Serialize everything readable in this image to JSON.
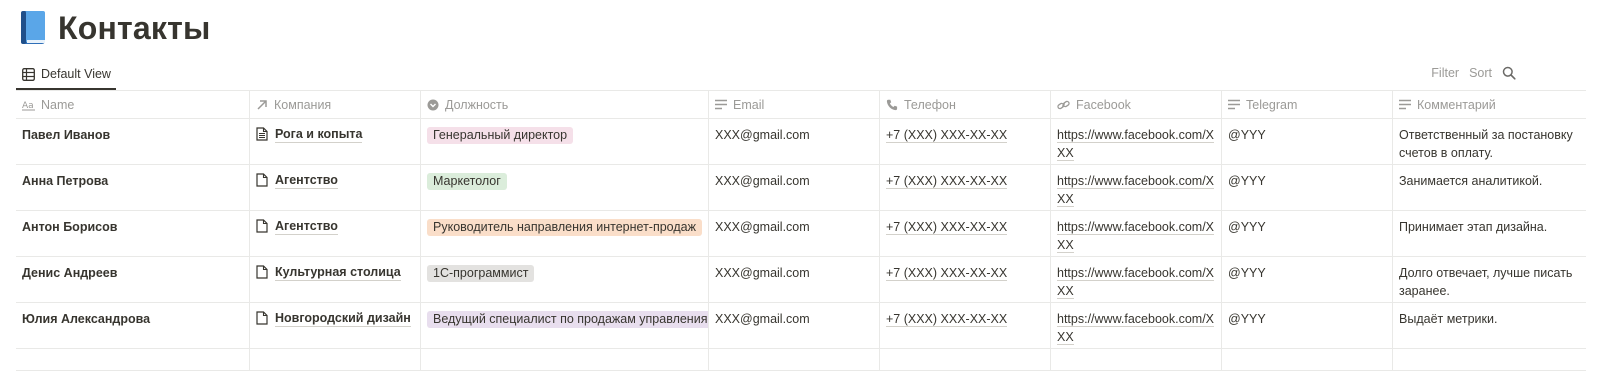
{
  "page": {
    "title": "Контакты",
    "icon": "blue-book-icon"
  },
  "toolbar": {
    "view_label": "Default View",
    "filter_label": "Filter",
    "sort_label": "Sort"
  },
  "columns": {
    "name": {
      "label": "Name",
      "icon": "text-aa-icon"
    },
    "company": {
      "label": "Компания",
      "icon": "relation-arrow-icon"
    },
    "position": {
      "label": "Должность",
      "icon": "select-icon"
    },
    "email": {
      "label": "Email",
      "icon": "lines-icon"
    },
    "phone": {
      "label": "Телефон",
      "icon": "phone-icon"
    },
    "facebook": {
      "label": "Facebook",
      "icon": "link-icon"
    },
    "telegram": {
      "label": "Telegram",
      "icon": "lines-icon"
    },
    "comment": {
      "label": "Комментарий",
      "icon": "lines-icon"
    }
  },
  "rows": [
    {
      "name": "Павел Иванов",
      "company": "Рога и копыта",
      "company_icon": "document-filled-icon",
      "position": "Генеральный директор",
      "position_color": "#f5e0e9",
      "email": "XXX@gmail.com",
      "phone": "+7 (XXX) XXX-XX-XX",
      "facebook": "https://www.facebook.com/XXX",
      "telegram": "@YYY",
      "comment": "Ответственный за постановку счетов в оплату."
    },
    {
      "name": "Анна Петрова",
      "company": "Агентство",
      "company_icon": "document-icon",
      "position": "Маркетолог",
      "position_color": "#dbeddb",
      "email": "XXX@gmail.com",
      "phone": "+7 (XXX) XXX-XX-XX",
      "facebook": "https://www.facebook.com/XXX",
      "telegram": "@YYY",
      "comment": "Занимается аналитикой."
    },
    {
      "name": "Антон Борисов",
      "company": "Агентство",
      "company_icon": "document-icon",
      "position": "Руководитель направления интернет-продаж",
      "position_color": "#fadec9",
      "email": "XXX@gmail.com",
      "phone": "+7 (XXX) XXX-XX-XX",
      "facebook": "https://www.facebook.com/XXX",
      "telegram": "@YYY",
      "comment": "Принимает этап дизайна."
    },
    {
      "name": "Денис Андреев",
      "company": "Культурная столица",
      "company_icon": "document-icon",
      "position": "1С-программист",
      "position_color": "#e3e2e0",
      "email": "XXX@gmail.com",
      "phone": "+7 (XXX) XXX-XX-XX",
      "facebook": "https://www.facebook.com/XXX",
      "telegram": "@YYY",
      "comment": "Долго отвечает, лучше писать заранее."
    },
    {
      "name": "Юлия Александрова",
      "company": "Новгородский дизайн",
      "company_icon": "document-icon",
      "position": "Ведущий специалист по продажам управления по",
      "position_color": "#e8deee",
      "email": "XXX@gmail.com",
      "phone": "+7 (XXX) XXX-XX-XX",
      "facebook": "https://www.facebook.com/XXX",
      "telegram": "@YYY",
      "comment": "Выдаёт метрики."
    }
  ]
}
